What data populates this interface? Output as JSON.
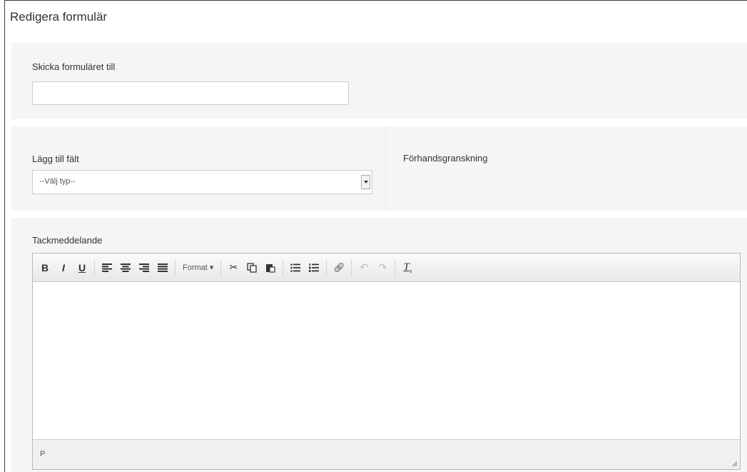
{
  "page": {
    "title": "Redigera formulär"
  },
  "send_to": {
    "label": "Skicka formuläret till",
    "value": "",
    "placeholder": ""
  },
  "add_field": {
    "label": "Lägg till fält",
    "selected": "--Välj typ--"
  },
  "preview": {
    "label": "Förhandsgranskning"
  },
  "thanks": {
    "label": "Tackmeddelande",
    "toolbar": {
      "bold": "B",
      "italic": "I",
      "underline": "U",
      "format": "Format ▾"
    },
    "status_path": "P",
    "content": ""
  },
  "colors": {
    "panel": "#f5f5f5",
    "border": "#ccc"
  }
}
